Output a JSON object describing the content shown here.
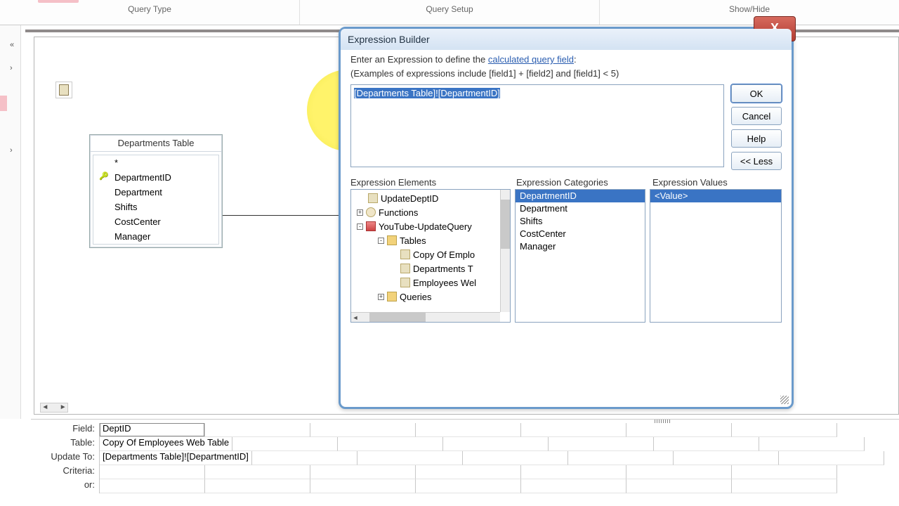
{
  "ribbon": {
    "groups": [
      "Query Type",
      "Query Setup",
      "Show/Hide"
    ]
  },
  "table_card": {
    "title": "Departments Table",
    "fields": [
      "*",
      "DepartmentID",
      "Department",
      "Shifts",
      "CostCenter",
      "Manager"
    ],
    "pk_index": 1
  },
  "dialog": {
    "title": "Expression Builder",
    "intro_pre": "Enter an Expression to define the ",
    "intro_link": "calculated query field",
    "intro_post": ":",
    "example": "(Examples of expressions include [field1] + [field2] and [field1] < 5)",
    "expression": "[Departments Table]![DepartmentID]",
    "buttons": {
      "ok": "OK",
      "cancel": "Cancel",
      "help": "Help",
      "less": "<< Less"
    },
    "pane_labels": {
      "elements": "Expression Elements",
      "categories": "Expression Categories",
      "values": "Expression Values"
    },
    "tree": {
      "root1": "UpdateDeptID",
      "functions": "Functions",
      "db": "YouTube-UpdateQuery",
      "tables": "Tables",
      "table_items": [
        "Copy Of Emplo",
        "Departments T",
        "Employees Wel"
      ],
      "queries": "Queries"
    },
    "categories": [
      "DepartmentID",
      "Department",
      "Shifts",
      "CostCenter",
      "Manager"
    ],
    "values": [
      "<Value>"
    ]
  },
  "grid": {
    "labels": {
      "field": "Field:",
      "table": "Table:",
      "update_to": "Update To:",
      "criteria": "Criteria:",
      "or": "or:"
    },
    "row1": {
      "field": "DeptID",
      "table": "Copy Of Employees Web Table",
      "update_to": "[Departments Table]![DepartmentID]"
    }
  }
}
